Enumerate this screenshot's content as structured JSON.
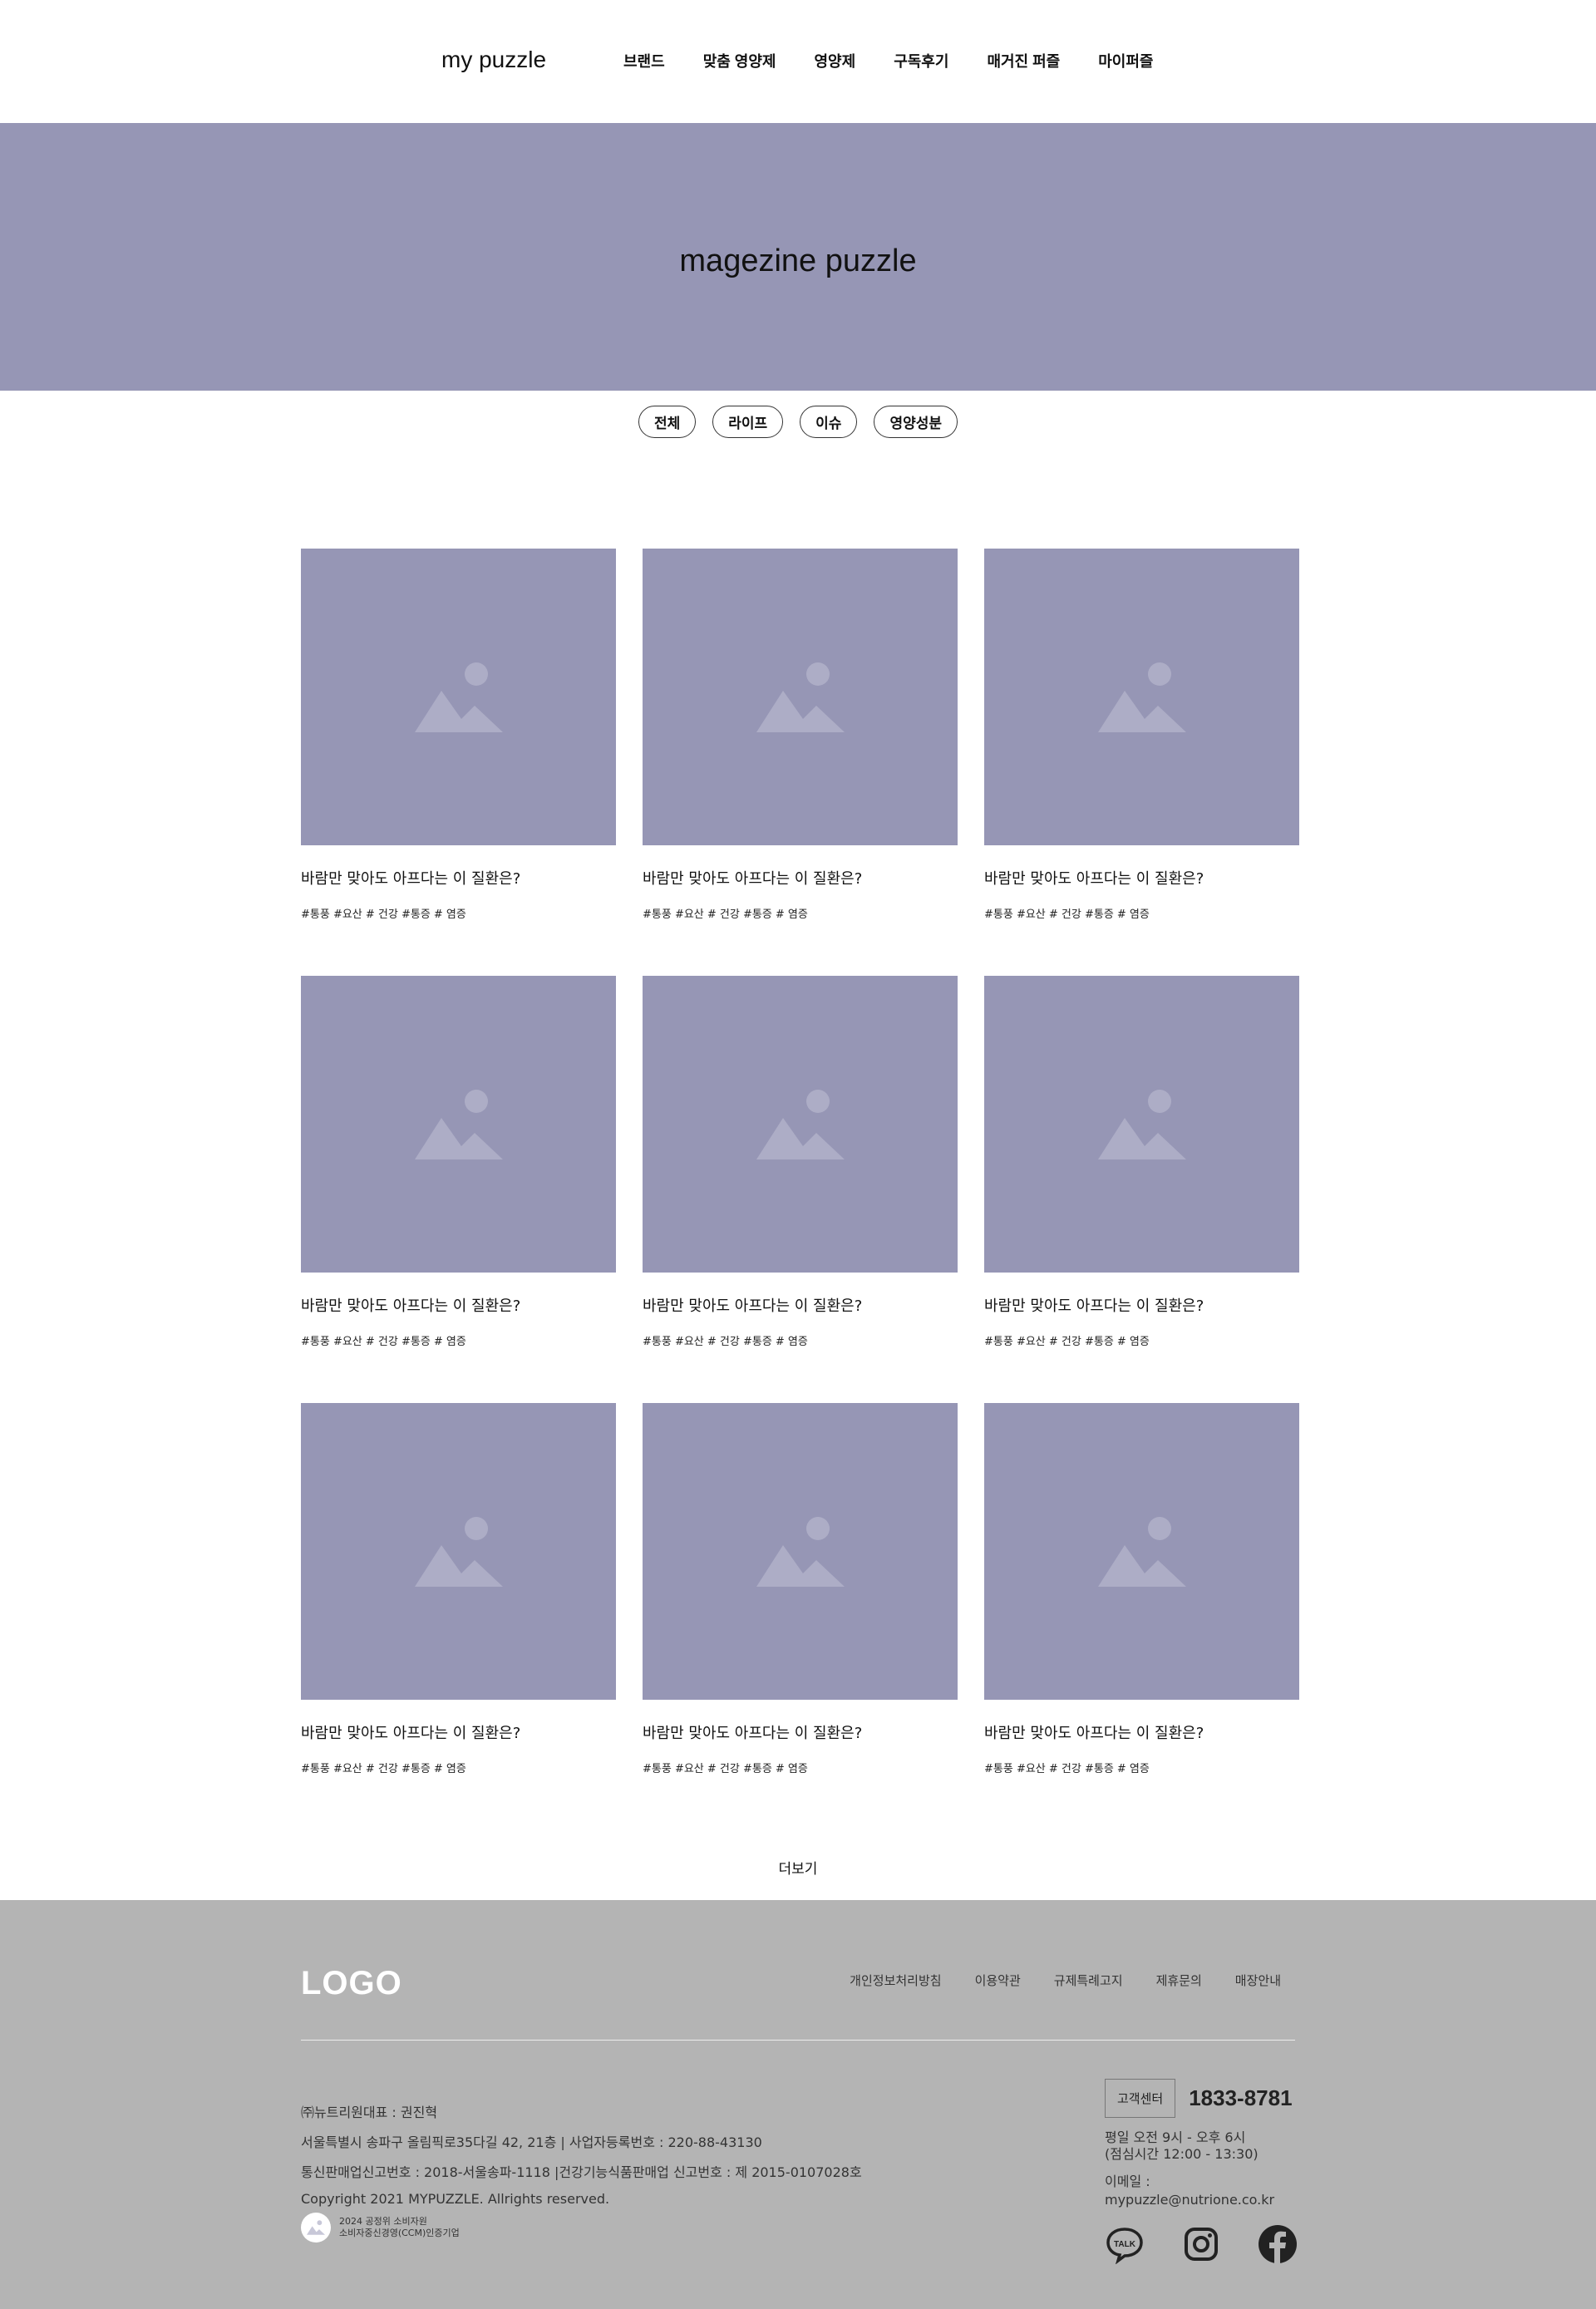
{
  "header": {
    "logo": "my puzzle",
    "nav": [
      "브랜드",
      "맞춤 영양제",
      "영양제",
      "구독후기",
      "매거진 퍼즐",
      "마이퍼즐"
    ]
  },
  "hero": {
    "title": "magezine puzzle"
  },
  "filters": [
    "전체",
    "라이프",
    "이슈",
    "영양성분"
  ],
  "cards": [
    {
      "title": "바람만 맞아도 아프다는 이 질환은?",
      "tags": "#통풍 #요산 # 건강 #통증 # 염증"
    },
    {
      "title": "바람만 맞아도 아프다는 이 질환은?",
      "tags": "#통풍 #요산 # 건강 #통증 # 염증"
    },
    {
      "title": "바람만 맞아도 아프다는 이 질환은?",
      "tags": "#통풍 #요산 # 건강 #통증 # 염증"
    },
    {
      "title": "바람만 맞아도 아프다는 이 질환은?",
      "tags": "#통풍 #요산 # 건강 #통증 # 염증"
    },
    {
      "title": "바람만 맞아도 아프다는 이 질환은?",
      "tags": "#통풍 #요산 # 건강 #통증 # 염증"
    },
    {
      "title": "바람만 맞아도 아프다는 이 질환은?",
      "tags": "#통풍 #요산 # 건강 #통증 # 염증"
    },
    {
      "title": "바람만 맞아도 아프다는 이 질환은?",
      "tags": "#통풍 #요산 # 건강 #통증 # 염증"
    },
    {
      "title": "바람만 맞아도 아프다는 이 질환은?",
      "tags": "#통풍 #요산 # 건강 #통증 # 염증"
    },
    {
      "title": "바람만 맞아도 아프다는 이 질환은?",
      "tags": "#통풍 #요산 # 건강 #통증 # 염증"
    }
  ],
  "more_label": "더보기",
  "footer": {
    "logo": "LOGO",
    "links": [
      "개인정보처리방침",
      "이용약관",
      "규제특례고지",
      "제휴문의",
      "매장안내"
    ],
    "info": [
      "㈜뉴트리원대표 : 권진혁",
      "서울특별시 송파구 올림픽로35다길 42, 21층 | 사업자등록번호 : 220-88-43130",
      "통신판매업신고번호 : 2018-서울송파-1118 |건강기능식품판매업 신고번호 : 제 2015-0107028호",
      "Copyright 2021 MYPUZZLE. Allrights reserved."
    ],
    "ccm_line1": "2024 공정위 소비자원",
    "ccm_line2": "소비자중신경영(CCM)인증기업",
    "cs_label": "고객센터",
    "cs_phone": "1833-8781",
    "hours_line1": "평일 오전 9시 - 오후 6시",
    "hours_line2": "(점심시간 12:00 - 13:30)",
    "email_label": "이메일 :",
    "email": "mypuzzle@nutrione.co.kr",
    "social_icons": [
      "kakaotalk-icon",
      "instagram-icon",
      "facebook-icon"
    ]
  },
  "colors": {
    "hero_bg": "#9696b5",
    "footer_bg": "#b4b4b4",
    "thumb_bg": "#9696b5"
  }
}
